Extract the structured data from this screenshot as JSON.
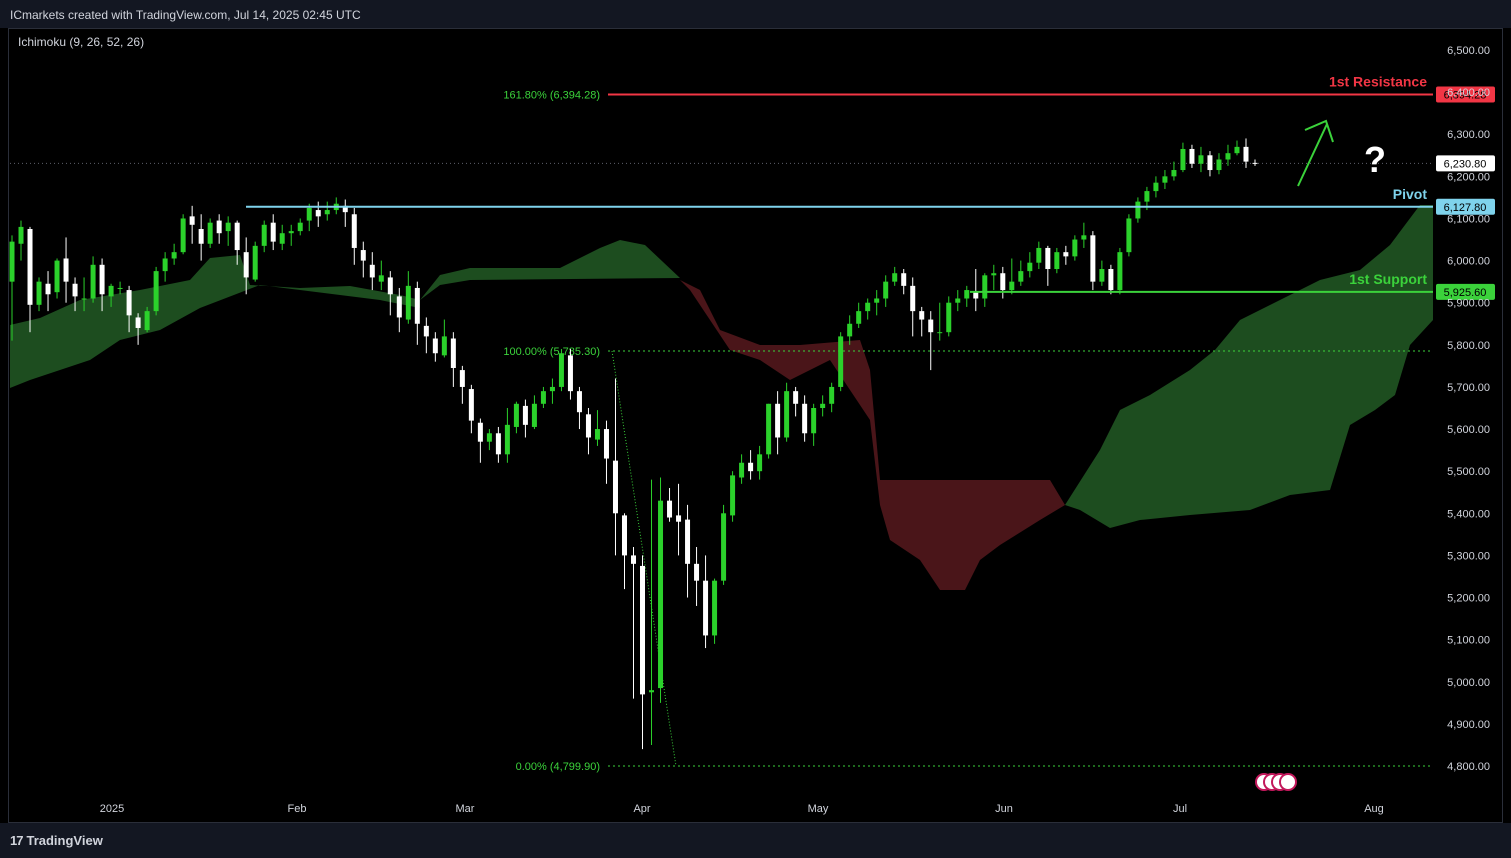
{
  "header": {
    "text": "ICmarkets created with TradingView.com, Jul 14, 2025 02:45 UTC"
  },
  "footer": {
    "brand": "TradingView",
    "logo_icon": "tradingview-logo-icon"
  },
  "chart_data": {
    "type": "candlestick",
    "indicator": "Ichimoku (9, 26, 52, 26)",
    "ylim": [
      4780,
      6530
    ],
    "y_ticks": [
      "6,500.00",
      "6,400.00",
      "6,300.00",
      "6,200.00",
      "6,100.00",
      "6,000.00",
      "5,900.00",
      "5,800.00",
      "5,700.00",
      "5,600.00",
      "5,500.00",
      "5,400.00",
      "5,300.00",
      "5,200.00",
      "5,100.00",
      "5,000.00",
      "4,900.00",
      "4,800.00"
    ],
    "x_ticks": [
      "2025",
      "Feb",
      "Mar",
      "Apr",
      "May",
      "Jun",
      "Jul",
      "Aug"
    ],
    "levels": {
      "resistance": {
        "label": "1st Resistance",
        "value": 6394.28,
        "price_label": "6,394.28",
        "color": "#f23645"
      },
      "pivot": {
        "label": "Pivot",
        "value": 6127.8,
        "price_label": "6,127.80",
        "color": "#7fd3ec"
      },
      "support": {
        "label": "1st Support",
        "value": 5925.6,
        "price_label": "5,925.60",
        "color": "#3bd23b"
      },
      "current": {
        "value": 6230.8,
        "price_label": "6,230.80"
      }
    },
    "fibonacci": [
      {
        "label": "161.80% (6,394.28)",
        "value": 6394.28
      },
      {
        "label": "100.00% (5,785.30)",
        "value": 5785.3
      },
      {
        "label": "0.00% (4,799.90)",
        "value": 4799.9
      }
    ],
    "annotations": {
      "arrow_icon": "up-arrow-icon",
      "question_mark": "?"
    },
    "candles": [
      [
        5950,
        6045,
        5810,
        6060
      ],
      [
        6040,
        6080,
        6000,
        6095
      ],
      [
        6075,
        5895,
        5830,
        6080
      ],
      [
        5895,
        5950,
        5880,
        5960
      ],
      [
        5945,
        5920,
        5880,
        5975
      ],
      [
        5925,
        6000,
        5910,
        6005
      ],
      [
        6005,
        5950,
        5900,
        6055
      ],
      [
        5945,
        5915,
        5880,
        5960
      ],
      [
        5910,
        5910,
        5880,
        5960
      ],
      [
        5910,
        5990,
        5900,
        6010
      ],
      [
        5990,
        5920,
        5880,
        6005
      ],
      [
        5915,
        5940,
        5890,
        5945
      ],
      [
        5935,
        5935,
        5920,
        5950
      ],
      [
        5930,
        5870,
        5830,
        5940
      ],
      [
        5865,
        5840,
        5800,
        5875
      ],
      [
        5835,
        5880,
        5830,
        5890
      ],
      [
        5880,
        5975,
        5870,
        5985
      ],
      [
        5975,
        6005,
        5950,
        6020
      ],
      [
        6005,
        6020,
        5990,
        6040
      ],
      [
        6020,
        6100,
        6015,
        6110
      ],
      [
        6105,
        6085,
        6040,
        6130
      ],
      [
        6075,
        6040,
        6000,
        6110
      ],
      [
        6040,
        6090,
        6030,
        6100
      ],
      [
        6095,
        6065,
        6040,
        6110
      ],
      [
        6070,
        6090,
        6035,
        6105
      ],
      [
        6090,
        6025,
        5990,
        6095
      ],
      [
        6020,
        5960,
        5920,
        6055
      ],
      [
        5955,
        6035,
        5950,
        6045
      ],
      [
        6035,
        6085,
        6020,
        6095
      ],
      [
        6090,
        6045,
        6025,
        6110
      ],
      [
        6040,
        6065,
        6025,
        6085
      ],
      [
        6065,
        6070,
        6035,
        6085
      ],
      [
        6070,
        6090,
        6060,
        6100
      ],
      [
        6095,
        6125,
        6070,
        6135
      ],
      [
        6120,
        6105,
        6080,
        6140
      ],
      [
        6110,
        6120,
        6095,
        6140
      ],
      [
        6120,
        6135,
        6110,
        6150
      ],
      [
        6130,
        6115,
        6080,
        6145
      ],
      [
        6110,
        6030,
        5990,
        6125
      ],
      [
        6025,
        6000,
        5960,
        6045
      ],
      [
        5990,
        5960,
        5930,
        6020
      ],
      [
        5950,
        5965,
        5930,
        6000
      ],
      [
        5960,
        5920,
        5870,
        5975
      ],
      [
        5915,
        5865,
        5830,
        5935
      ],
      [
        5860,
        5940,
        5850,
        5975
      ],
      [
        5935,
        5850,
        5800,
        5950
      ],
      [
        5845,
        5820,
        5780,
        5865
      ],
      [
        5815,
        5780,
        5760,
        5830
      ],
      [
        5775,
        5820,
        5770,
        5860
      ],
      [
        5815,
        5745,
        5700,
        5830
      ],
      [
        5740,
        5700,
        5660,
        5750
      ],
      [
        5695,
        5620,
        5590,
        5705
      ],
      [
        5615,
        5570,
        5520,
        5625
      ],
      [
        5570,
        5590,
        5550,
        5600
      ],
      [
        5590,
        5540,
        5520,
        5605
      ],
      [
        5540,
        5610,
        5520,
        5650
      ],
      [
        5605,
        5660,
        5590,
        5665
      ],
      [
        5655,
        5610,
        5580,
        5670
      ],
      [
        5605,
        5660,
        5600,
        5680
      ],
      [
        5660,
        5690,
        5650,
        5700
      ],
      [
        5690,
        5700,
        5660,
        5720
      ],
      [
        5700,
        5780,
        5690,
        5790
      ],
      [
        5775,
        5690,
        5670,
        5790
      ],
      [
        5690,
        5640,
        5600,
        5700
      ],
      [
        5635,
        5580,
        5540,
        5650
      ],
      [
        5575,
        5600,
        5560,
        5645
      ],
      [
        5600,
        5530,
        5470,
        5620
      ],
      [
        5525,
        5400,
        5300,
        5720
      ],
      [
        5395,
        5300,
        5220,
        5400
      ],
      [
        5300,
        5280,
        4960,
        5320
      ],
      [
        5275,
        4970,
        4840,
        5300
      ],
      [
        4975,
        4980,
        4850,
        5480
      ],
      [
        4985,
        5430,
        4950,
        5485
      ],
      [
        5430,
        5390,
        5380,
        5460
      ],
      [
        5395,
        5380,
        5300,
        5470
      ],
      [
        5385,
        5280,
        5200,
        5420
      ],
      [
        5280,
        5240,
        5180,
        5320
      ],
      [
        5240,
        5110,
        5080,
        5300
      ],
      [
        5110,
        5240,
        5090,
        5245
      ],
      [
        5240,
        5400,
        5230,
        5420
      ],
      [
        5395,
        5490,
        5380,
        5500
      ],
      [
        5485,
        5520,
        5470,
        5540
      ],
      [
        5520,
        5500,
        5480,
        5550
      ],
      [
        5500,
        5540,
        5480,
        5560
      ],
      [
        5540,
        5660,
        5530,
        5660
      ],
      [
        5660,
        5580,
        5540,
        5690
      ],
      [
        5580,
        5690,
        5570,
        5710
      ],
      [
        5690,
        5660,
        5630,
        5700
      ],
      [
        5660,
        5590,
        5570,
        5680
      ],
      [
        5590,
        5650,
        5560,
        5660
      ],
      [
        5650,
        5660,
        5630,
        5680
      ],
      [
        5660,
        5700,
        5640,
        5710
      ],
      [
        5700,
        5820,
        5690,
        5830
      ],
      [
        5820,
        5850,
        5800,
        5870
      ],
      [
        5850,
        5880,
        5840,
        5900
      ],
      [
        5880,
        5900,
        5860,
        5910
      ],
      [
        5900,
        5910,
        5870,
        5930
      ],
      [
        5910,
        5950,
        5890,
        5965
      ],
      [
        5950,
        5970,
        5940,
        5985
      ],
      [
        5970,
        5940,
        5920,
        5980
      ],
      [
        5940,
        5880,
        5820,
        5960
      ],
      [
        5880,
        5860,
        5820,
        5890
      ],
      [
        5860,
        5830,
        5740,
        5880
      ],
      [
        5830,
        5830,
        5810,
        5900
      ],
      [
        5830,
        5900,
        5820,
        5915
      ],
      [
        5900,
        5910,
        5880,
        5930
      ],
      [
        5910,
        5930,
        5890,
        5940
      ],
      [
        5925,
        5910,
        5880,
        5980
      ],
      [
        5910,
        5965,
        5890,
        5970
      ],
      [
        5965,
        5970,
        5930,
        5990
      ],
      [
        5970,
        5930,
        5910,
        5985
      ],
      [
        5930,
        5950,
        5920,
        6005
      ],
      [
        5950,
        5975,
        5940,
        6000
      ],
      [
        5975,
        5995,
        5960,
        6020
      ],
      [
        5995,
        6030,
        5980,
        6045
      ],
      [
        6030,
        5980,
        5940,
        6035
      ],
      [
        5980,
        6020,
        5970,
        6030
      ],
      [
        6020,
        6010,
        5990,
        6035
      ],
      [
        6010,
        6050,
        6000,
        6060
      ],
      [
        6050,
        6060,
        6030,
        6090
      ],
      [
        6060,
        5950,
        5930,
        6070
      ],
      [
        5950,
        5980,
        5940,
        6000
      ],
      [
        5980,
        5930,
        5920,
        5990
      ],
      [
        5930,
        6020,
        5920,
        6030
      ],
      [
        6020,
        6100,
        6010,
        6110
      ],
      [
        6100,
        6140,
        6090,
        6150
      ],
      [
        6140,
        6165,
        6120,
        6175
      ],
      [
        6165,
        6185,
        6150,
        6200
      ],
      [
        6185,
        6200,
        6170,
        6215
      ],
      [
        6200,
        6215,
        6190,
        6235
      ],
      [
        6215,
        6265,
        6210,
        6280
      ],
      [
        6265,
        6230,
        6220,
        6275
      ],
      [
        6230,
        6250,
        6210,
        6270
      ],
      [
        6250,
        6215,
        6200,
        6260
      ],
      [
        6215,
        6240,
        6205,
        6255
      ],
      [
        6240,
        6255,
        6225,
        6275
      ],
      [
        6255,
        6270,
        6250,
        6285
      ],
      [
        6270,
        6235,
        6220,
        6290
      ],
      [
        6232,
        6231,
        6225,
        6240
      ]
    ]
  }
}
